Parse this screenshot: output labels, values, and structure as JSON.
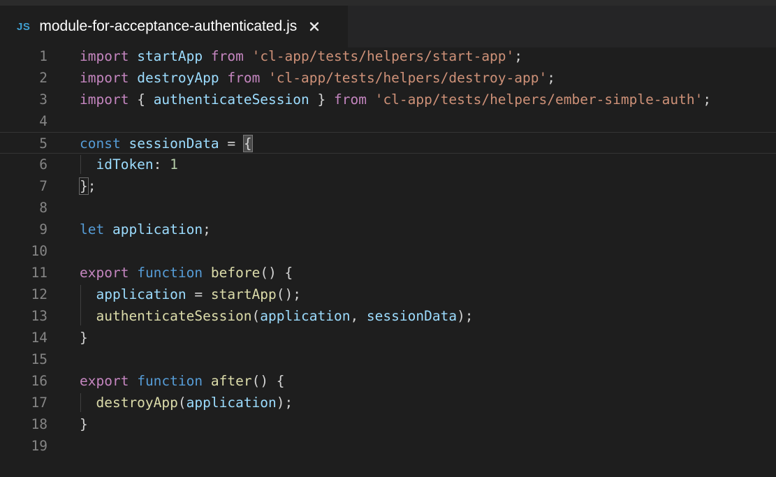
{
  "tab": {
    "icon_label": "JS",
    "filename": "module-for-acceptance-authenticated.js",
    "close_icon": "close-icon"
  },
  "editor": {
    "line_numbers": [
      "1",
      "2",
      "3",
      "4",
      "5",
      "6",
      "7",
      "8",
      "9",
      "10",
      "11",
      "12",
      "13",
      "14",
      "15",
      "16",
      "17",
      "18",
      "19"
    ],
    "current_line": 5,
    "lines": [
      [
        [
          "import",
          "kw-purple"
        ],
        [
          " ",
          "plain"
        ],
        [
          "startApp",
          "ident"
        ],
        [
          " ",
          "plain"
        ],
        [
          "from",
          "kw-purple"
        ],
        [
          " ",
          "plain"
        ],
        [
          "'cl-app/tests/helpers/start-app'",
          "str"
        ],
        [
          ";",
          "plain"
        ]
      ],
      [
        [
          "import",
          "kw-purple"
        ],
        [
          " ",
          "plain"
        ],
        [
          "destroyApp",
          "ident"
        ],
        [
          " ",
          "plain"
        ],
        [
          "from",
          "kw-purple"
        ],
        [
          " ",
          "plain"
        ],
        [
          "'cl-app/tests/helpers/destroy-app'",
          "str"
        ],
        [
          ";",
          "plain"
        ]
      ],
      [
        [
          "import",
          "kw-purple"
        ],
        [
          " { ",
          "plain"
        ],
        [
          "authenticateSession",
          "ident"
        ],
        [
          " } ",
          "plain"
        ],
        [
          "from",
          "kw-purple"
        ],
        [
          " ",
          "plain"
        ],
        [
          "'cl-app/tests/helpers/ember-simple-auth'",
          "str"
        ],
        [
          ";",
          "plain"
        ]
      ],
      [],
      [
        [
          "const",
          "kw-blue"
        ],
        [
          " ",
          "plain"
        ],
        [
          "sessionData",
          "ident"
        ],
        [
          " = ",
          "plain"
        ],
        [
          "{",
          "plain bracket-hl"
        ]
      ],
      [
        [
          "  ",
          "plain"
        ],
        [
          "idToken",
          "ident"
        ],
        [
          ": ",
          "plain"
        ],
        [
          "1",
          "num"
        ]
      ],
      [
        [
          "}",
          "plain bracket-box"
        ],
        [
          ";",
          "plain"
        ]
      ],
      [],
      [
        [
          "let",
          "kw-blue"
        ],
        [
          " ",
          "plain"
        ],
        [
          "application",
          "ident"
        ],
        [
          ";",
          "plain"
        ]
      ],
      [],
      [
        [
          "export",
          "kw-purple"
        ],
        [
          " ",
          "plain"
        ],
        [
          "function",
          "kw-blue"
        ],
        [
          " ",
          "plain"
        ],
        [
          "before",
          "fn"
        ],
        [
          "() {",
          "plain"
        ]
      ],
      [
        [
          "  ",
          "plain"
        ],
        [
          "application",
          "ident"
        ],
        [
          " = ",
          "plain"
        ],
        [
          "startApp",
          "fn"
        ],
        [
          "();",
          "plain"
        ]
      ],
      [
        [
          "  ",
          "plain"
        ],
        [
          "authenticateSession",
          "fn"
        ],
        [
          "(",
          "plain"
        ],
        [
          "application",
          "ident"
        ],
        [
          ", ",
          "plain"
        ],
        [
          "sessionData",
          "ident"
        ],
        [
          ");",
          "plain"
        ]
      ],
      [
        [
          "}",
          "plain"
        ]
      ],
      [],
      [
        [
          "export",
          "kw-purple"
        ],
        [
          " ",
          "plain"
        ],
        [
          "function",
          "kw-blue"
        ],
        [
          " ",
          "plain"
        ],
        [
          "after",
          "fn"
        ],
        [
          "() {",
          "plain"
        ]
      ],
      [
        [
          "  ",
          "plain"
        ],
        [
          "destroyApp",
          "fn"
        ],
        [
          "(",
          "plain"
        ],
        [
          "application",
          "ident"
        ],
        [
          ");",
          "plain"
        ]
      ],
      [
        [
          "}",
          "plain"
        ]
      ],
      []
    ]
  },
  "colors": {
    "background": "#1e1e1e",
    "tabbar": "#252526",
    "js_icon": "#3f9fd0",
    "keyword_purple": "#c586c0",
    "keyword_blue": "#569cd6",
    "string": "#ce9178",
    "identifier": "#9cdcfe",
    "function": "#dcdcaa",
    "number": "#b5cea8",
    "line_number": "#858585"
  }
}
